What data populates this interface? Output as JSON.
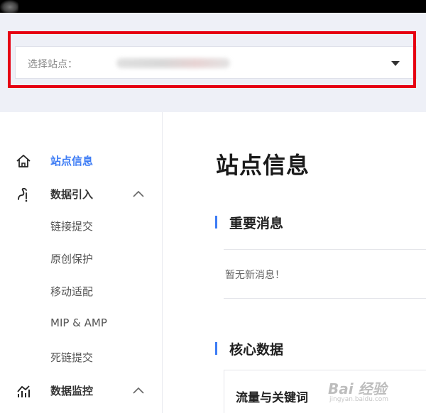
{
  "site_selector": {
    "label": "选择站点："
  },
  "sidebar": {
    "items": [
      {
        "label": "站点信息",
        "icon": "home-icon",
        "active": true
      },
      {
        "label": "数据引入",
        "icon": "data-import-icon",
        "expanded": true
      },
      {
        "label": "数据监控",
        "icon": "chart-icon",
        "expanded": true
      }
    ],
    "sub_items": [
      "链接提交",
      "原创保护",
      "移动适配",
      "MIP & AMP",
      "死链提交"
    ]
  },
  "main": {
    "page_title": "站点信息",
    "section_messages": "重要消息",
    "no_messages": "暂无新消息！",
    "section_core": "核心数据",
    "card_title": "流量与关键词"
  },
  "watermark": {
    "text": "Bai 经验",
    "sub": "jingyan.baidu.com"
  },
  "colors": {
    "accent": "#3d7cf5",
    "highlight_border": "#e60012"
  }
}
